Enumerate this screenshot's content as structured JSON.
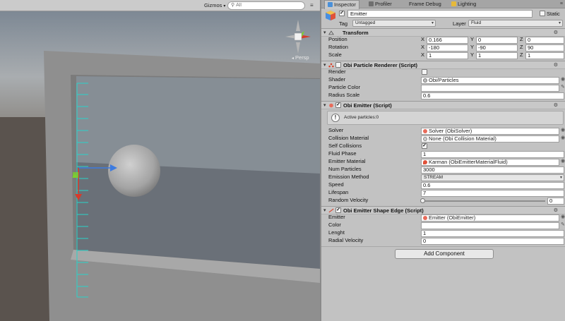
{
  "scene": {
    "gizmos_label": "Gizmos",
    "search_placeholder": "All",
    "persp_label": "Persp"
  },
  "tabs": [
    {
      "label": "Inspector",
      "icon": "info-icon"
    },
    {
      "label": "Profiler",
      "icon": "profiler-icon"
    },
    {
      "label": "Frame Debug",
      "icon": "frame-debug-icon"
    },
    {
      "label": "Lighting",
      "icon": "lighting-icon"
    }
  ],
  "object": {
    "name": "Emitter",
    "active": true,
    "static_label": "Static",
    "tag_label": "Tag",
    "tag_value": "Untagged",
    "layer_label": "Layer",
    "layer_value": "Fluid"
  },
  "transform": {
    "title": "Transform",
    "position_label": "Position",
    "rotation_label": "Rotation",
    "scale_label": "Scale",
    "axis_x": "X",
    "axis_y": "Y",
    "axis_z": "Z",
    "position": {
      "x": "0.166",
      "y": "0",
      "z": "0"
    },
    "rotation": {
      "x": "-180",
      "y": "-90",
      "z": "90"
    },
    "scale": {
      "x": "1",
      "y": "1",
      "z": "1"
    }
  },
  "particle_renderer": {
    "title": "Obi Particle Renderer (Script)",
    "render_label": "Render",
    "render_checked": false,
    "shader_label": "Shader",
    "shader_value": "Obi/Particles",
    "particle_color_label": "Particle Color",
    "particle_color": "#ffffff",
    "radius_scale_label": "Radius Scale",
    "radius_scale_value": "0.6"
  },
  "emitter": {
    "title": "Obi Emitter (Script)",
    "info_text": "Active particles:0",
    "solver_label": "Solver",
    "solver_value": "Solver (ObiSolver)",
    "collision_material_label": "Collision Material",
    "collision_material_value": "None (Obi Collision Material)",
    "self_collisions_label": "Self Collisions",
    "self_collisions_checked": true,
    "fluid_phase_label": "Fluid Phase",
    "fluid_phase_value": "1",
    "emitter_material_label": "Emitter Material",
    "emitter_material_value": "Karman (ObiEmitterMaterialFluid)",
    "num_particles_label": "Num Particles",
    "num_particles_value": "3000",
    "emission_method_label": "Emission Method",
    "emission_method_value": "STREAM",
    "speed_label": "Speed",
    "speed_value": "0.6",
    "lifespan_label": "Lifespan",
    "lifespan_value": "7",
    "random_velocity_label": "Random Velocity",
    "random_velocity_value": "0"
  },
  "shape_edge": {
    "title": "Obi Emitter Shape Edge (Script)",
    "emitter_label": "Emitter",
    "emitter_value": "Emitter (ObiEmitter)",
    "color_label": "Color",
    "color_value": "#ffffff",
    "lenght_label": "Lenght",
    "lenght_value": "1",
    "radial_velocity_label": "Radial Velocity",
    "radial_velocity_value": "0"
  },
  "add_component_label": "Add Component",
  "colors": {
    "scene_floor": "#5a534e",
    "scene_sky_top": "#7f8b97",
    "frame_gray": "#8e8e8e",
    "gizmo_cyan": "#2ad3c9",
    "axis_red": "#d83a2a",
    "axis_green": "#7ccf2e",
    "axis_blue": "#3c7be0"
  }
}
